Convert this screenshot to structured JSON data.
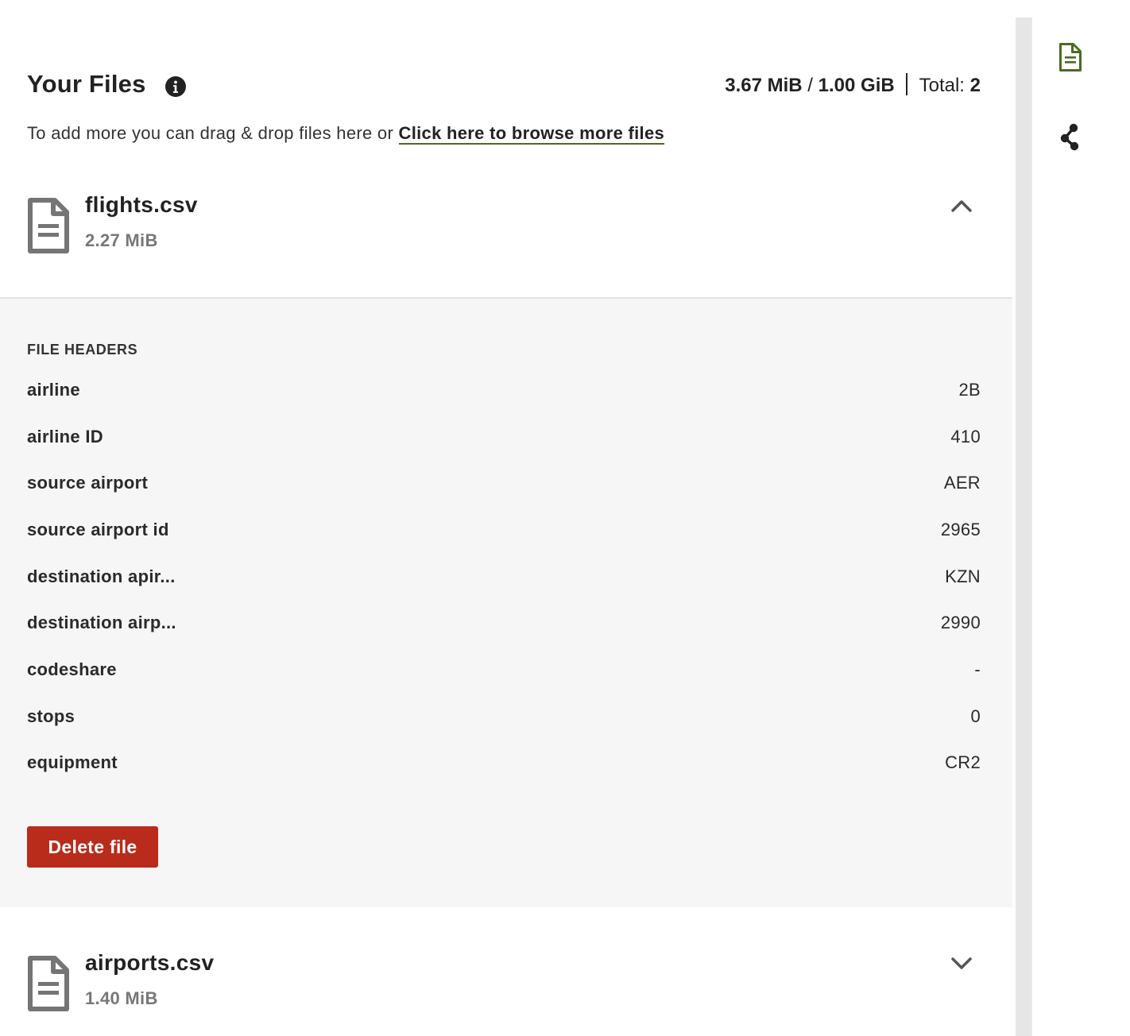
{
  "header": {
    "title": "Your Files",
    "info_icon": "info-icon",
    "used": "3.67 MiB",
    "slash": "/",
    "limit": "1.00 GiB",
    "total_label": "Total:",
    "total_count": "2"
  },
  "subline": {
    "text": "To add more you can drag & drop files here or",
    "link": "Click here to browse more files"
  },
  "files": [
    {
      "name": "flights.csv",
      "size": "2.27 MiB",
      "expanded": true,
      "icon": "file-document-icon",
      "chevron": "chevron-up-icon",
      "headers_title": "FILE HEADERS",
      "headers": [
        {
          "name": "airline",
          "value": "2B"
        },
        {
          "name": "airline ID",
          "value": "410"
        },
        {
          "name": "source airport",
          "value": "AER"
        },
        {
          "name": "source airport id",
          "value": "2965"
        },
        {
          "name": "destination apir...",
          "value": "KZN"
        },
        {
          "name": "destination airp...",
          "value": "2990"
        },
        {
          "name": "codeshare",
          "value": "-"
        },
        {
          "name": "stops",
          "value": "0"
        },
        {
          "name": "equipment",
          "value": "CR2"
        }
      ],
      "delete_label": "Delete file"
    },
    {
      "name": "airports.csv",
      "size": "1.40 MiB",
      "expanded": false,
      "icon": "file-document-icon",
      "chevron": "chevron-down-icon"
    }
  ],
  "rail": {
    "items": [
      {
        "icon": "document-icon",
        "active": true
      },
      {
        "icon": "share-nodes-icon",
        "active": false
      }
    ]
  },
  "colors": {
    "accent": "#4a6b22",
    "danger": "#b92b1b",
    "panel_bg": "#f6f6f6",
    "muted_text": "#777777"
  }
}
